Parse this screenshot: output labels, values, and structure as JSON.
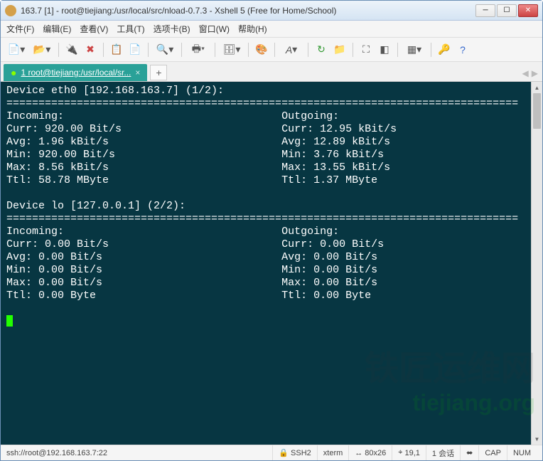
{
  "window": {
    "title": "163.7 [1]  - root@tiejiang:/usr/local/src/nload-0.7.3 - Xshell 5 (Free for Home/School)"
  },
  "menu": {
    "file": "文件(F)",
    "edit": "编辑(E)",
    "view": "查看(V)",
    "tools": "工具(T)",
    "tabs": "选项卡(B)",
    "window": "窗口(W)",
    "help": "帮助(H)"
  },
  "tab": {
    "label": "1 root@tiejiang:/usr/local/sr..."
  },
  "terminal": {
    "dev0_header": "Device eth0 [192.168.163.7] (1/2):",
    "rule": "================================================================================",
    "in_label": "Incoming:",
    "out_label": "Outgoing:",
    "e0": {
      "in_curr": "Curr: 920.00 Bit/s",
      "out_curr": "Curr: 12.95 kBit/s",
      "in_avg": "Avg: 1.96 kBit/s",
      "out_avg": "Avg: 12.89 kBit/s",
      "in_min": "Min: 920.00 Bit/s",
      "out_min": "Min: 3.76 kBit/s",
      "in_max": "Max: 8.56 kBit/s",
      "out_max": "Max: 13.55 kBit/s",
      "in_ttl": "Ttl: 58.78 MByte",
      "out_ttl": "Ttl: 1.37 MByte"
    },
    "dev1_header": "Device lo [127.0.0.1] (2/2):",
    "lo": {
      "in_curr": "Curr: 0.00 Bit/s",
      "out_curr": "Curr: 0.00 Bit/s",
      "in_avg": "Avg: 0.00 Bit/s",
      "out_avg": "Avg: 0.00 Bit/s",
      "in_min": "Min: 0.00 Bit/s",
      "out_min": "Min: 0.00 Bit/s",
      "in_max": "Max: 0.00 Bit/s",
      "out_max": "Max: 0.00 Bit/s",
      "in_ttl": "Ttl: 0.00 Byte",
      "out_ttl": "Ttl: 0.00 Byte"
    }
  },
  "status": {
    "conn": "ssh://root@192.168.163.7:22",
    "proto": "SSH2",
    "term": "xterm",
    "size": "80x26",
    "cursor": "19,1",
    "sessions": "1 会话",
    "cap": "CAP",
    "num": "NUM"
  },
  "watermark": {
    "line1": "铁匠运维网",
    "line2": "tiejiang.org"
  }
}
